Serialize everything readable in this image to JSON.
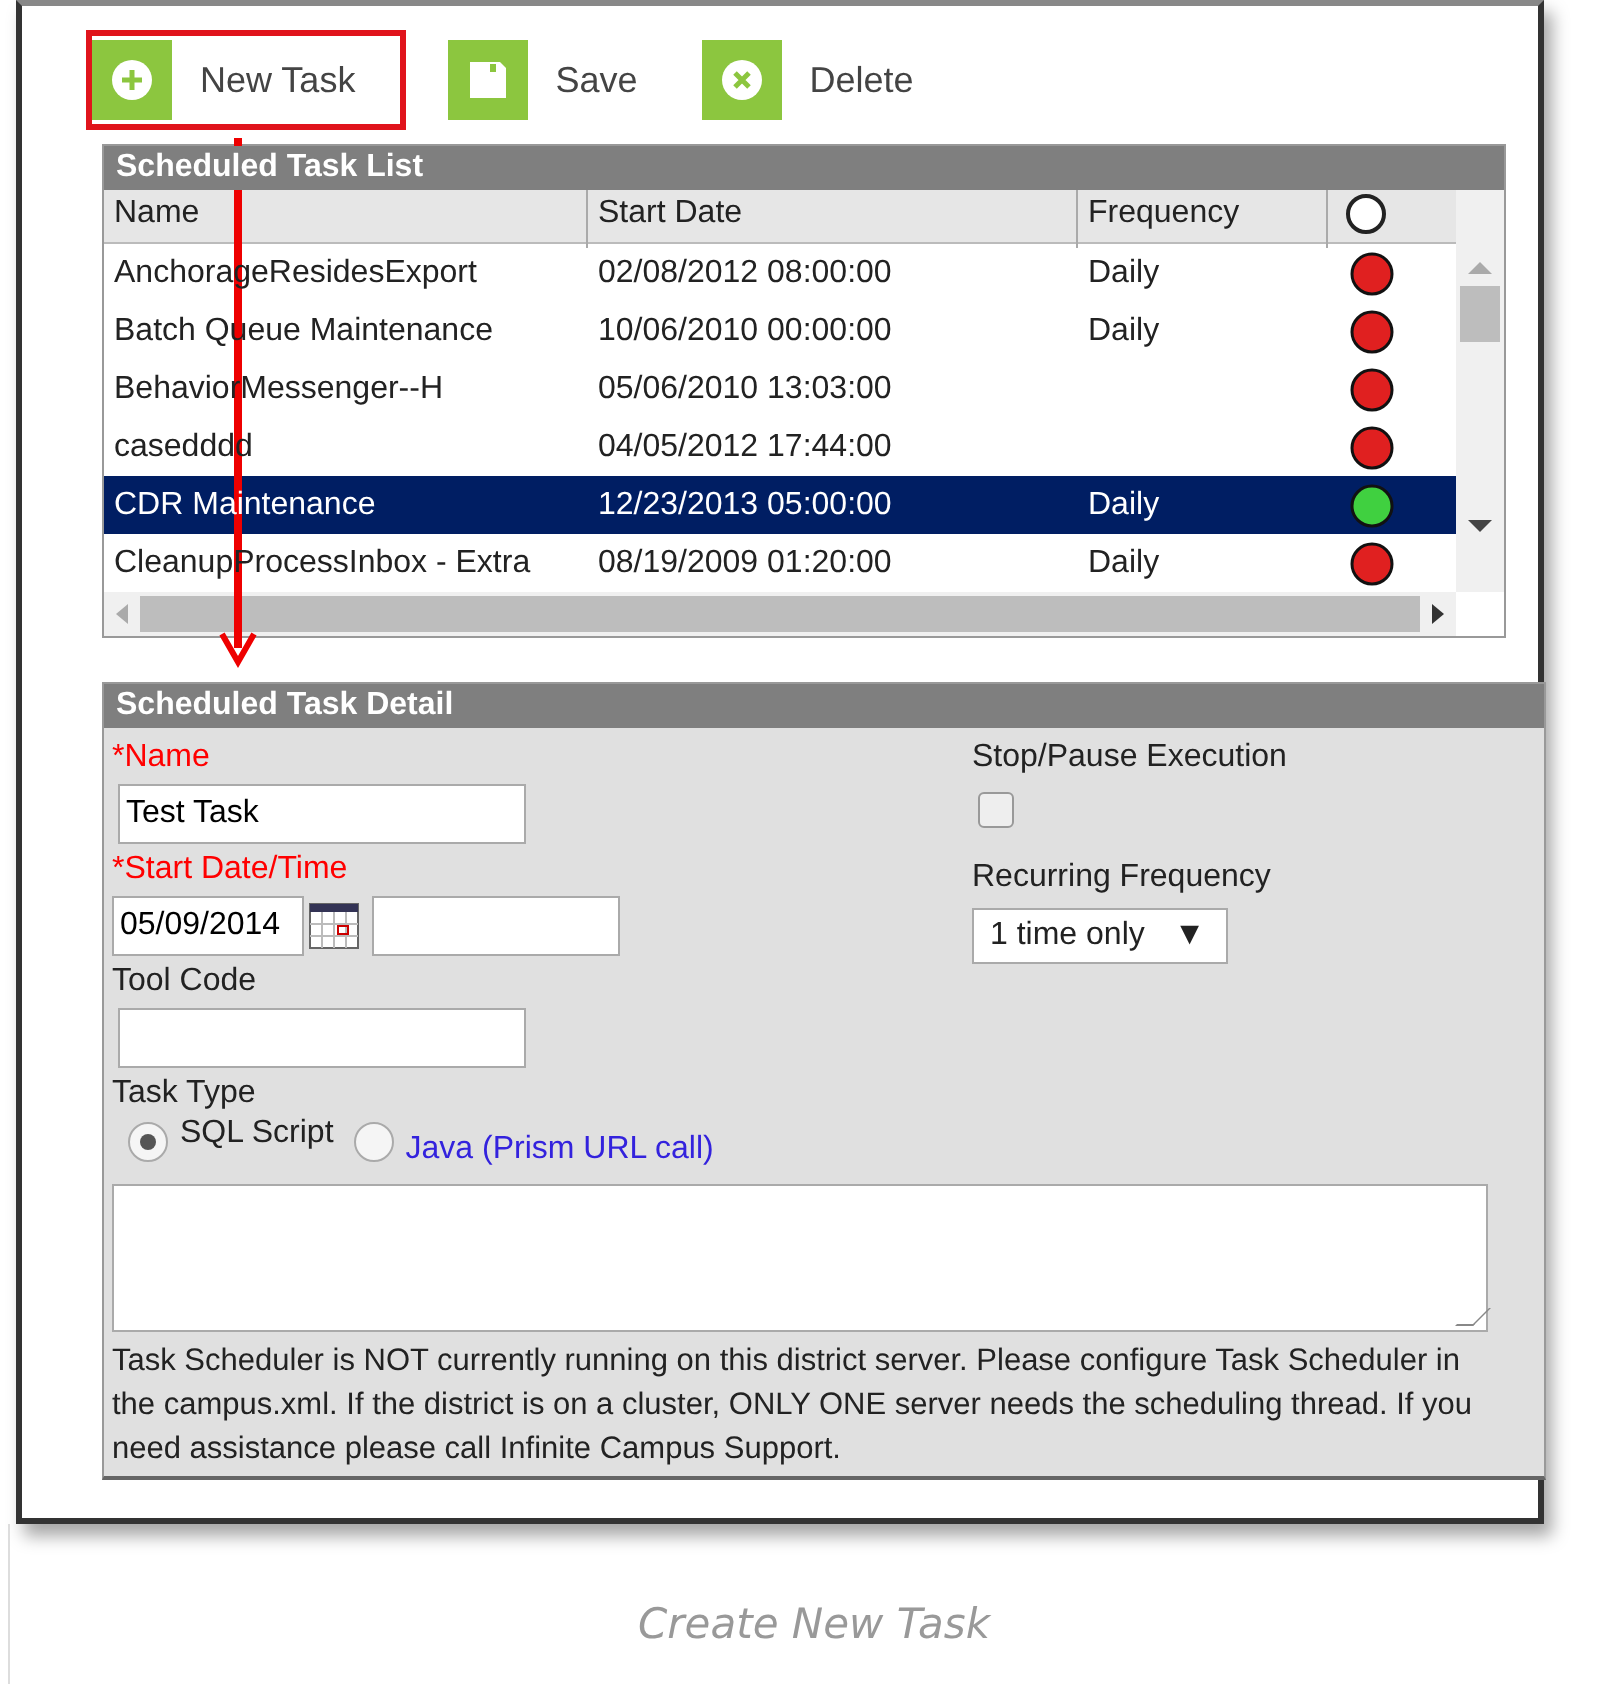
{
  "toolbar": [
    {
      "kind": "new",
      "label": "New Task",
      "highlighted": true
    },
    {
      "kind": "save",
      "label": "Save",
      "highlighted": false
    },
    {
      "kind": "delete",
      "label": "Delete",
      "highlighted": false
    }
  ],
  "task_list": {
    "title": "Scheduled Task List",
    "columns": [
      "Name",
      "Start Date",
      "Frequency"
    ],
    "rows": [
      {
        "name": "AnchorageResidesExport",
        "start_date": "02/08/2012 08:00:00",
        "frequency": "Daily",
        "color": "#e02020",
        "selected": false
      },
      {
        "name": "Batch Queue Maintenance",
        "start_date": "10/06/2010 00:00:00",
        "frequency": "Daily",
        "color": "#e02020",
        "selected": false
      },
      {
        "name": "BehaviorMessenger--H",
        "start_date": "05/06/2010 13:03:00",
        "frequency": "",
        "color": "#e02020",
        "selected": false
      },
      {
        "name": "casedddd",
        "start_date": "04/05/2012 17:44:00",
        "frequency": "",
        "color": "#e02020",
        "selected": false
      },
      {
        "name": "CDR Maintenance",
        "start_date": "12/23/2013 05:00:00",
        "frequency": "Daily",
        "color": "#40d040",
        "selected": true
      },
      {
        "name": "CleanupProcessInbox - Extra",
        "start_date": "08/19/2009 01:20:00",
        "frequency": "Daily",
        "color": "#e02020",
        "selected": false
      }
    ]
  },
  "task_detail": {
    "title": "Scheduled Task Detail",
    "name": {
      "label": "*Name",
      "value": "Test Task"
    },
    "start": {
      "label": "*Start Date/Time",
      "date": "05/09/2014"
    },
    "tool_code": {
      "label": "Tool Code"
    },
    "task_type": {
      "label": "Task Type",
      "options": [
        {
          "label": "SQL Script",
          "kind": "plain",
          "selected": true
        },
        {
          "label": "Java (Prism URL call)",
          "kind": "link",
          "selected": false
        }
      ]
    },
    "stop_pause": {
      "label": "Stop/Pause Execution",
      "checked": false
    },
    "recurring": {
      "label": "Recurring Frequency",
      "value": "1 time only",
      "arrow": "▼"
    },
    "notice": "Task Scheduler is NOT currently running on this district server. Please configure Task Scheduler in the campus.xml. If the district is on a cluster, ONLY ONE server needs the scheduling thread. If you need assistance please call Infinite Campus Support."
  },
  "caption": "Create New Task"
}
